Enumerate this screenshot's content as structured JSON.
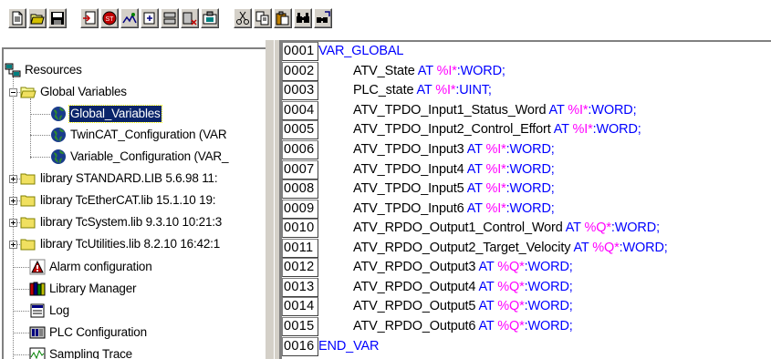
{
  "toolbar": {
    "buttons": [
      "new-icon",
      "open-icon",
      "save-icon",
      "login-icon",
      "stop-icon",
      "run-icon",
      "step-icon",
      "cycle-icon",
      "logout-icon",
      "watch-icon",
      "cut-icon",
      "copy-icon",
      "paste-icon",
      "find-icon",
      "replace-icon"
    ]
  },
  "tree": {
    "root": "Resources",
    "global_variables": "Global Variables",
    "gv_items": [
      "Global_Variables",
      "TwinCAT_Configuration (VAR",
      "Variable_Configuration (VAR_"
    ],
    "libraries": [
      "library STANDARD.LIB 5.6.98 11:",
      "library TcEtherCAT.lib 15.1.10 19:",
      "library TcSystem.lib 9.3.10 10:21:3",
      "library TcUtilities.lib 8.2.10 16:42:1"
    ],
    "tools": [
      "Alarm configuration",
      "Library Manager",
      "Log",
      "PLC Configuration",
      "Sampling Trace"
    ]
  },
  "editor": {
    "lines": [
      {
        "no": "0001",
        "indent": false,
        "kw": "VAR_GLOBAL",
        "name": "",
        "at": "",
        "addr": "",
        "type": ""
      },
      {
        "no": "0002",
        "indent": true,
        "kw": "",
        "name": "ATV_State",
        "at": "AT",
        "addr": "%I*",
        "type": ":WORD;"
      },
      {
        "no": "0003",
        "indent": true,
        "kw": "",
        "name": "PLC_state",
        "at": "AT",
        "addr": "%I*",
        "type": ":UINT;"
      },
      {
        "no": "0004",
        "indent": true,
        "kw": "",
        "name": "ATV_TPDO_Input1_Status_Word",
        "at": "AT",
        "addr": "%I*",
        "type": ":WORD;"
      },
      {
        "no": "0005",
        "indent": true,
        "kw": "",
        "name": "ATV_TPDO_Input2_Control_Effort",
        "at": "AT",
        "addr": "%I*",
        "type": ":WORD;"
      },
      {
        "no": "0006",
        "indent": true,
        "kw": "",
        "name": "ATV_TPDO_Input3",
        "at": "AT",
        "addr": "%I*",
        "type": ":WORD;"
      },
      {
        "no": "0007",
        "indent": true,
        "kw": "",
        "name": "ATV_TPDO_Input4",
        "at": "AT",
        "addr": "%I*",
        "type": ":WORD;"
      },
      {
        "no": "0008",
        "indent": true,
        "kw": "",
        "name": "ATV_TPDO_Input5",
        "at": "AT",
        "addr": "%I*",
        "type": ":WORD;"
      },
      {
        "no": "0009",
        "indent": true,
        "kw": "",
        "name": "ATV_TPDO_Input6",
        "at": "AT",
        "addr": "%I*",
        "type": ":WORD;"
      },
      {
        "no": "0010",
        "indent": true,
        "kw": "",
        "name": "ATV_RPDO_Output1_Control_Word",
        "at": "AT",
        "addr": "%Q*",
        "type": ":WORD;"
      },
      {
        "no": "0011",
        "indent": true,
        "kw": "",
        "name": "ATV_RPDO_Output2_Target_Velocity",
        "at": "AT",
        "addr": "%Q*",
        "type": ":WORD;"
      },
      {
        "no": "0012",
        "indent": true,
        "kw": "",
        "name": "ATV_RPDO_Output3",
        "at": "AT",
        "addr": "%Q*",
        "type": ":WORD;"
      },
      {
        "no": "0013",
        "indent": true,
        "kw": "",
        "name": "ATV_RPDO_Output4",
        "at": "AT",
        "addr": "%Q*",
        "type": ":WORD;"
      },
      {
        "no": "0014",
        "indent": true,
        "kw": "",
        "name": "ATV_RPDO_Output5",
        "at": "AT",
        "addr": "%Q*",
        "type": ":WORD;"
      },
      {
        "no": "0015",
        "indent": true,
        "kw": "",
        "name": "ATV_RPDO_Output6",
        "at": "AT",
        "addr": "%Q*",
        "type": ":WORD;"
      },
      {
        "no": "0016",
        "indent": false,
        "kw": "END_VAR",
        "name": "",
        "at": "",
        "addr": "",
        "type": ""
      }
    ]
  },
  "colors": {
    "keyword": "#0000ff",
    "address": "#ff00ff",
    "selection": "#0a246a",
    "face": "#d4d0c8"
  }
}
